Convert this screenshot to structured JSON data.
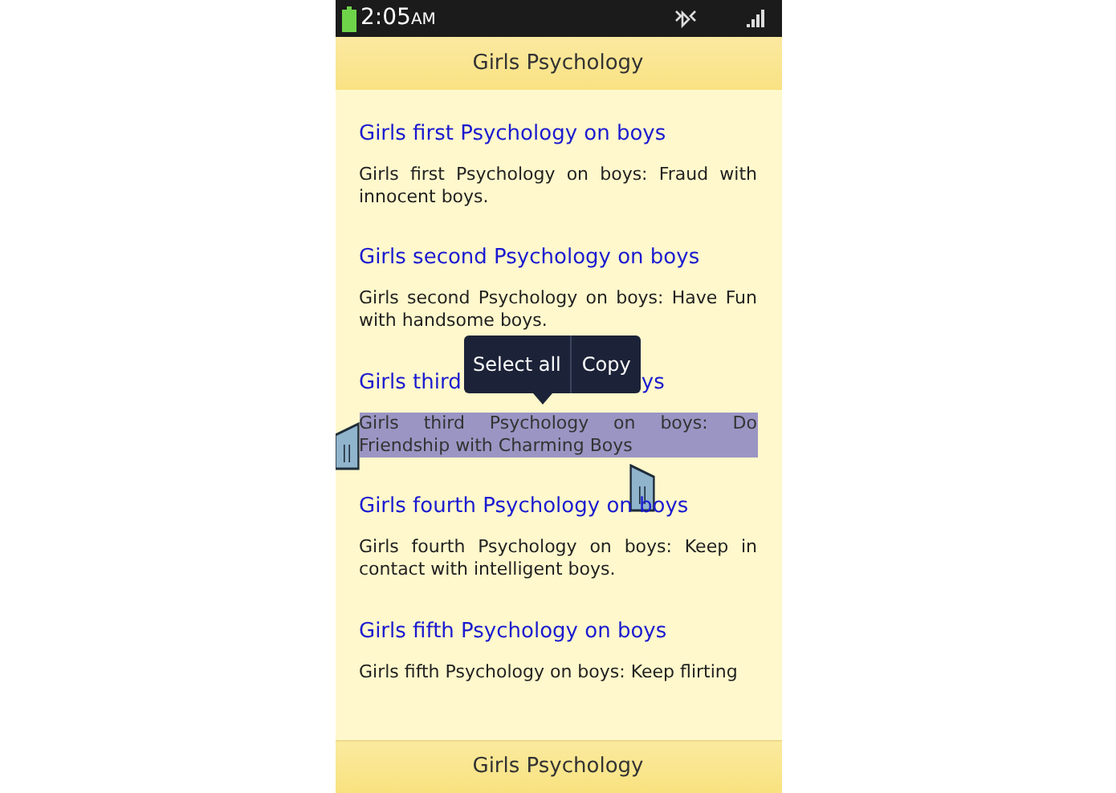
{
  "status_bar": {
    "time": "2:05",
    "ampm": "AM"
  },
  "header": {
    "title": "Girls Psychology"
  },
  "articles": [
    {
      "heading": [
        "Girls first Psychology on boys"
      ],
      "body": "Girls first Psychology on boys: Fraud with innocent boys.",
      "selected": false
    },
    {
      "heading": [
        "Girls second Psychology on boys"
      ],
      "body": "Girls second Psychology on boys: Have Fun with handsome boys.",
      "selected": false
    },
    {
      "heading": [
        "Girls third",
        "ys"
      ],
      "body": "Girls third Psychology on boys: Do Friendship with Charming Boys",
      "selected": true
    },
    {
      "heading": [
        "Girls fourth Psychology on boys"
      ],
      "body": "Girls fourth Psychology on boys: Keep in contact with intelligent boys.",
      "selected": false
    },
    {
      "heading": [
        "Girls fifth Psychology on boys"
      ],
      "body": "Girls fifth Psychology on boys: Keep flirting",
      "selected": false
    }
  ],
  "popup": {
    "buttons": [
      "Select all",
      "Copy"
    ]
  },
  "footer": {
    "title": "Girls Psychology"
  }
}
